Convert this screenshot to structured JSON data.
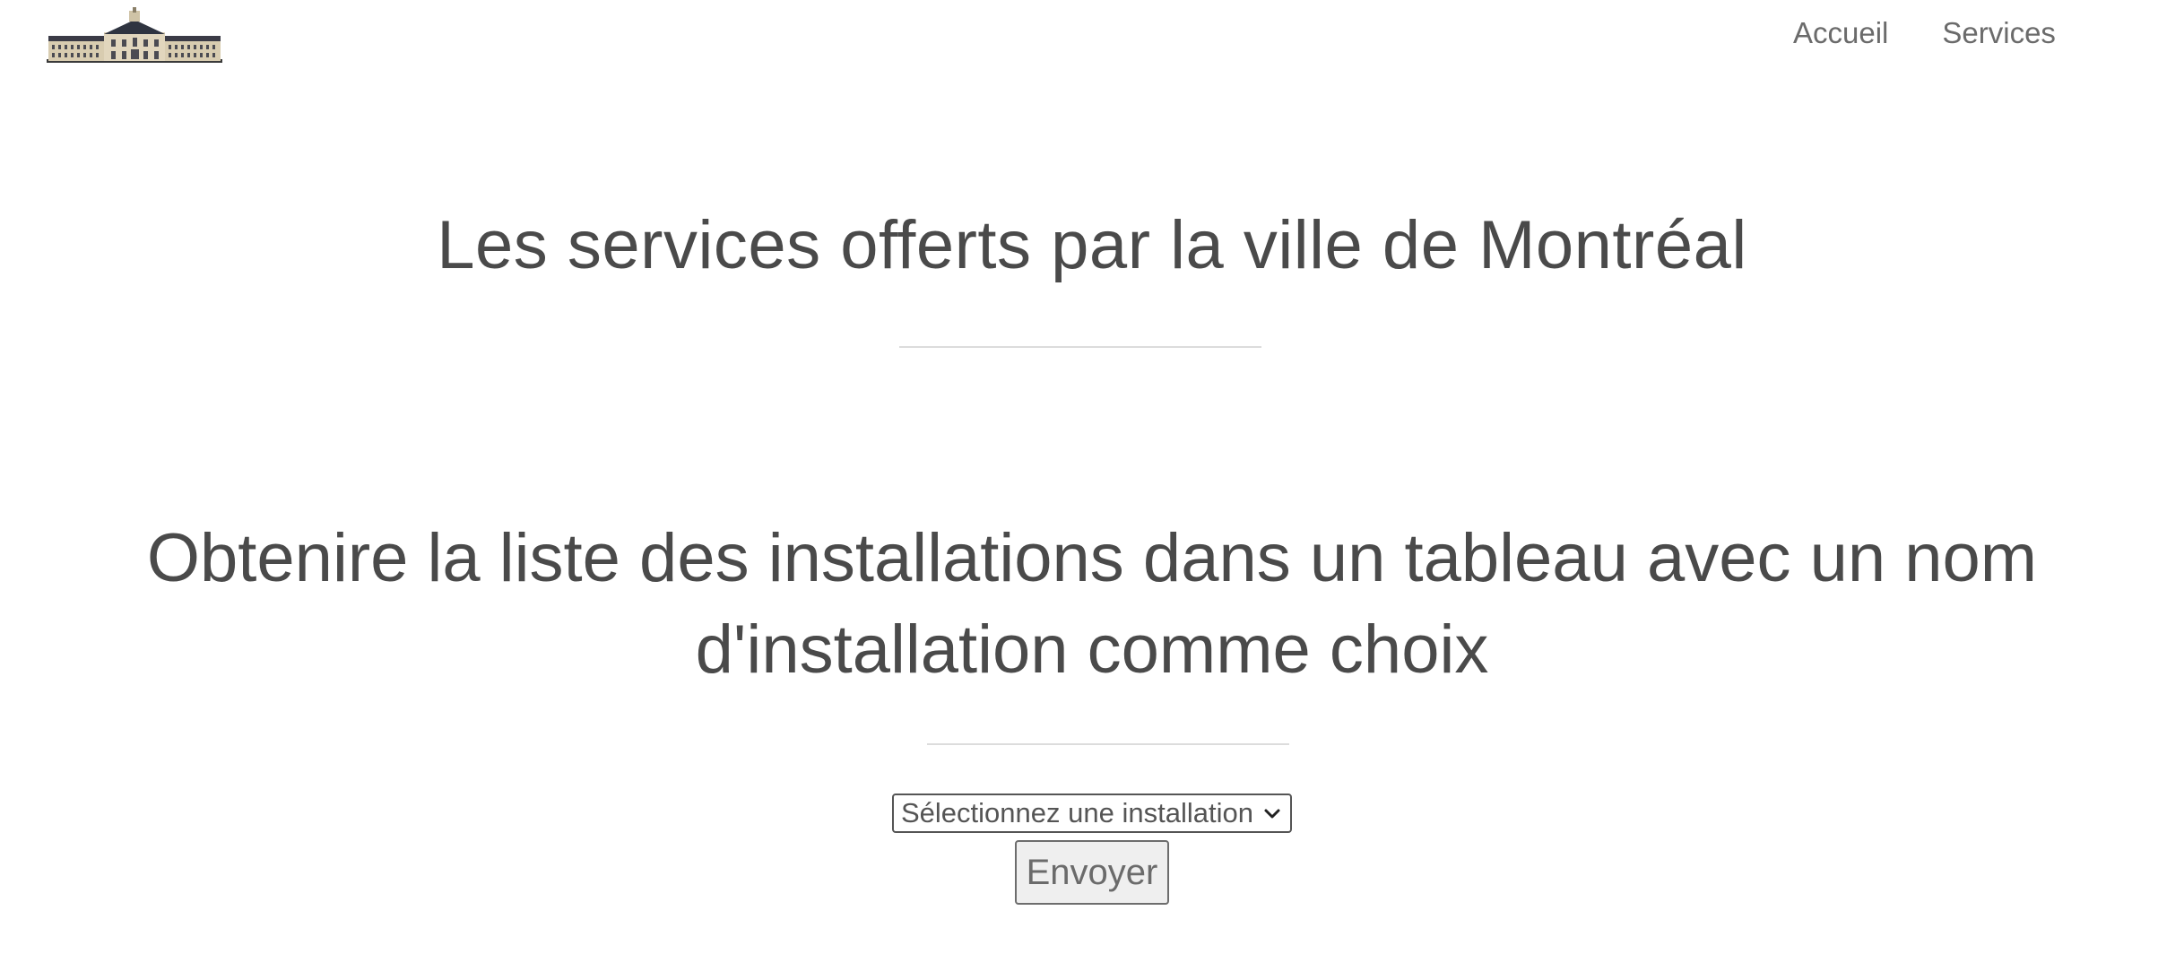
{
  "navbar": {
    "logo_icon": "city-hall-building-icon",
    "links": [
      {
        "label": "Accueil"
      },
      {
        "label": "Services"
      }
    ]
  },
  "main": {
    "title": "Les services offerts par la ville de Montréal",
    "subtitle_line1": "Obtenire la liste des installations dans un tableau avec un nom",
    "subtitle_line2": "d'installation comme choix",
    "form": {
      "select_value": "Sélectionnez une installation",
      "submit_label": "Envoyer"
    }
  },
  "colors": {
    "text": "#4a4a4a",
    "nav_text": "#6b6b6b",
    "rule": "#dcdcdc",
    "button_bg": "#efefef"
  }
}
